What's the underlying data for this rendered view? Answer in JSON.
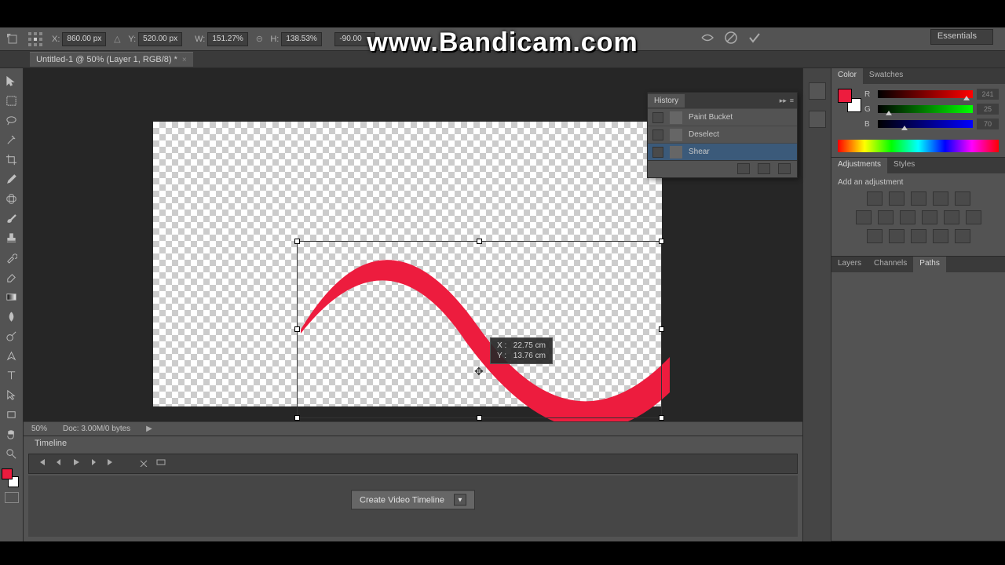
{
  "watermark": "www.Bandicam.com",
  "workspace": "Essentials",
  "options": {
    "x_label": "X:",
    "x": "860.00 px",
    "y_label": "Y:",
    "y": "520.00 px",
    "w_label": "W:",
    "w": "151.27%",
    "h_label": "H:",
    "h": "138.53%",
    "angle": "-90.00"
  },
  "doc_tab": {
    "title": "Untitled-1 @ 50% (Layer 1, RGB/8) *",
    "close": "×"
  },
  "history": {
    "title": "History",
    "items": [
      {
        "label": "Paint Bucket"
      },
      {
        "label": "Deselect"
      },
      {
        "label": "Shear"
      }
    ]
  },
  "coord_tip": {
    "x_label": "X :",
    "x_val": "22.75 cm",
    "y_label": "Y :",
    "y_val": "13.76 cm"
  },
  "status": {
    "zoom": "50%",
    "doc_info": "Doc: 3.00M/0 bytes"
  },
  "timeline": {
    "title": "Timeline",
    "create_btn": "Create Video Timeline"
  },
  "color_panel": {
    "tab1": "Color",
    "tab2": "Swatches",
    "r_label": "R",
    "r_val": "241",
    "g_label": "G",
    "g_val": "25",
    "b_label": "B",
    "b_val": "70"
  },
  "adjustments": {
    "tab1": "Adjustments",
    "tab2": "Styles",
    "title": "Add an adjustment"
  },
  "paths_panel": {
    "tab1": "Layers",
    "tab2": "Channels",
    "tab3": "Paths"
  }
}
